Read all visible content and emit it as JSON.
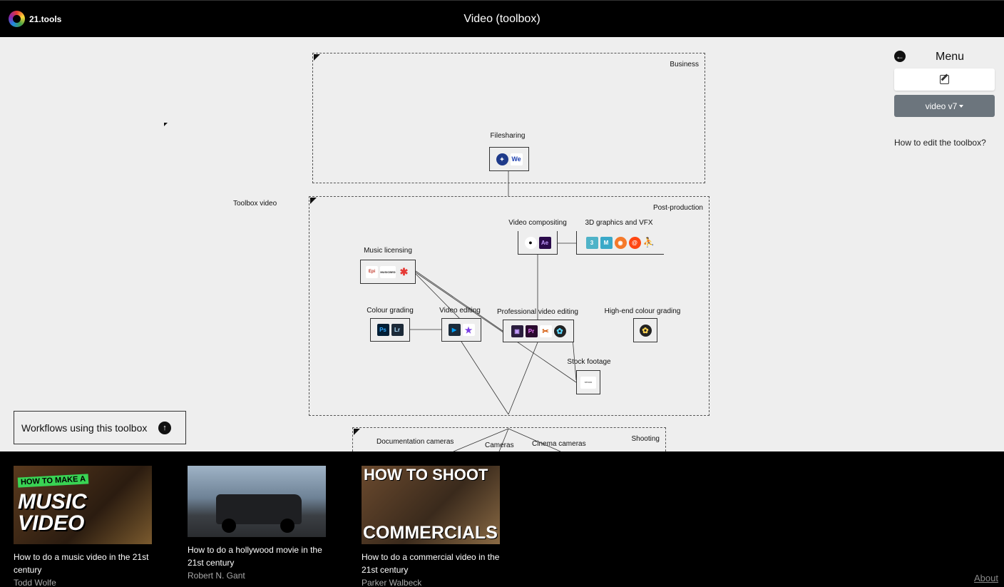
{
  "app": {
    "logo_text": "21.tools",
    "title": "Video (toolbox)"
  },
  "toolbox": {
    "label": "Toolbox video",
    "groups": {
      "business": "Business",
      "post_production": "Post-production",
      "shooting": "Shooting"
    },
    "nodes": {
      "filesharing": "Filesharing",
      "video_compositing": "Video compositing",
      "graphics_3d_vfx": "3D graphics and VFX",
      "music_licensing": "Music licensing",
      "colour_grading": "Colour grading",
      "video_editing": "Video editing",
      "professional_video_editing": "Professional video editing",
      "high_end_colour_grading": "High-end colour grading",
      "stock_footage": "Stock footage",
      "documentation_cameras": "Documentation cameras",
      "cameras": "Cameras",
      "cinema_cameras": "Cinema cameras"
    },
    "tool_icons": {
      "photoshop": "Ps",
      "lightroom": "Lr",
      "premiere": "Pr",
      "after_effects": "Ae",
      "wetransfer": "We",
      "cinema4d": "3",
      "maya": "M",
      "music_bed": "MUSICBED",
      "stock_text": "STOCK"
    }
  },
  "menu": {
    "title": "Menu",
    "version_label": "video v7",
    "help_link": "How to edit the toolbox?"
  },
  "workflows": {
    "button_label": "Workflows using this toolbox",
    "items": [
      {
        "title": "How to do a music video in the 21st century",
        "author": "Todd Wolfe",
        "thumb_text_top": "HOW TO MAKE A",
        "thumb_text_main": "MUSIC VIDEO"
      },
      {
        "title": "How to do a hollywood movie in the 21st century",
        "author": "Robert N. Gant"
      },
      {
        "title": "How to do a commercial video in the 21st century",
        "author": "Parker Walbeck",
        "thumb_text_top": "HOW TO SHOOT",
        "thumb_text_main": "COMMERCIALS"
      }
    ]
  },
  "footer": {
    "about_label": "About"
  },
  "colors": {
    "topbar": "#000000",
    "canvas": "#eeeeee",
    "version_button": "#6c757d",
    "bottombar": "#000000"
  }
}
